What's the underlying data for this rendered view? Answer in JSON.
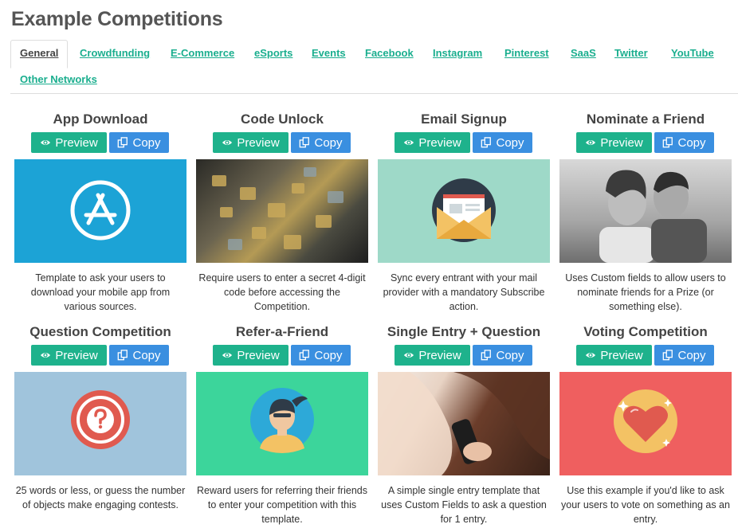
{
  "page_title": "Example Competitions",
  "tabs": [
    {
      "label": "General",
      "active": true
    },
    {
      "label": "Crowdfunding"
    },
    {
      "label": "E-Commerce"
    },
    {
      "label": "eSports"
    },
    {
      "label": "Events"
    },
    {
      "label": "Facebook"
    },
    {
      "label": "Instagram"
    },
    {
      "label": "Pinterest"
    },
    {
      "label": "SaaS"
    },
    {
      "label": "Twitter"
    },
    {
      "label": "YouTube"
    },
    {
      "label": "Other Networks"
    }
  ],
  "buttons": {
    "preview_label": "Preview",
    "copy_label": "Copy",
    "preview_icon": "eye-icon",
    "copy_icon": "copy-icon"
  },
  "cards": [
    {
      "title": "App Download",
      "description": "Template to ask your users to download your mobile app from various sources.",
      "image": "app-store-icon",
      "image_bg": "#1ca3d6"
    },
    {
      "title": "Code Unlock",
      "description": "Require users to enter a secret 4-digit code before accessing the Competition.",
      "image": "padlocks-photo",
      "image_bg": "#6d6a5a"
    },
    {
      "title": "Email Signup",
      "description": "Sync every entrant with your mail provider with a mandatory Subscribe action.",
      "image": "envelope-icon",
      "image_bg": "#9ed9c8"
    },
    {
      "title": "Nominate a Friend",
      "description": "Uses Custom fields to allow users to nominate friends for a Prize (or something else).",
      "image": "couple-photo",
      "image_bg": "#8a8a8a"
    },
    {
      "title": "Question Competition",
      "description": "25 words or less, or guess the number of objects make engaging contests.",
      "image": "question-mark-icon",
      "image_bg": "#a0c4dc"
    },
    {
      "title": "Refer-a-Friend",
      "description": "Reward users for referring their friends to enter your competition with this template.",
      "image": "person-avatar-icon",
      "image_bg": "#3cd59b"
    },
    {
      "title": "Single Entry + Question",
      "description": "A simple single entry template that uses Custom Fields to ask a question for 1 entry.",
      "image": "phone-call-photo",
      "image_bg": "#7a5040"
    },
    {
      "title": "Voting Competition",
      "description": "Use this example if you'd like to ask your users to vote on something as an entry.",
      "image": "heart-icon",
      "image_bg": "#ef5f5f"
    }
  ]
}
